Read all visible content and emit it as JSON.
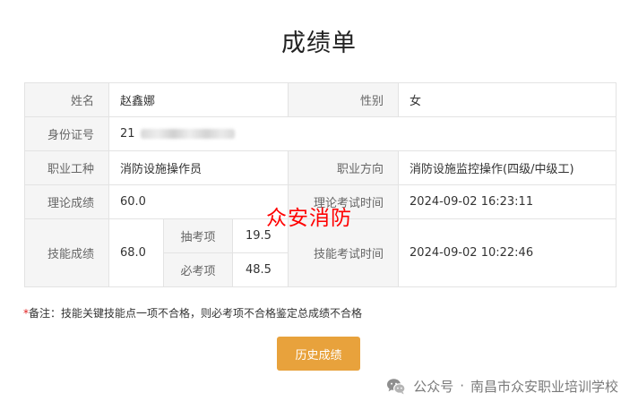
{
  "page_title": "成绩单",
  "table": {
    "name_label": "姓名",
    "name_value": "赵鑫娜",
    "gender_label": "性别",
    "gender_value": "女",
    "id_label": "身份证号",
    "id_value": "21",
    "occupation_label": "职业工种",
    "occupation_value": "消防设施操作员",
    "direction_label": "职业方向",
    "direction_value": "消防设施监控操作(四级/中级工)",
    "theory_label": "理论成绩",
    "theory_value": "60.0",
    "theory_time_label": "理论考试时间",
    "theory_time_value": "2024-09-02 16:23:11",
    "skill_label": "技能成绩",
    "skill_value": "68.0",
    "random_label": "抽考项",
    "random_value": "19.5",
    "required_label": "必考项",
    "required_value": "48.5",
    "skill_time_label": "技能考试时间",
    "skill_time_value": "2024-09-02 10:22:46"
  },
  "watermark": "众安消防",
  "note": {
    "star": "*",
    "text": "备注：技能关键技能点一项不合格，则必考项不合格鉴定总成绩不合格"
  },
  "history_button": "历史成绩",
  "footer": {
    "source": "公众号",
    "separator": "·",
    "org": "南昌市众安职业培训学校"
  },
  "colors": {
    "accent_button": "#e8a23c",
    "skill_score": "#2f88c8",
    "watermark": "#ff0000"
  }
}
